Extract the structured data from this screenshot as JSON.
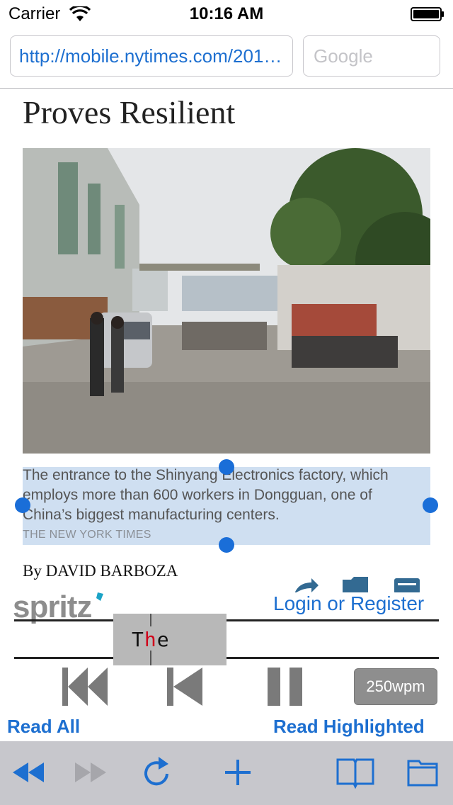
{
  "status_bar": {
    "carrier": "Carrier",
    "time": "10:16 AM"
  },
  "address_bar": {
    "url": "http://mobile.nytimes.com/2014/...",
    "search_placeholder": "Google"
  },
  "article": {
    "headline": "Proves Resilient",
    "photo_icon": "factory-entrance-photo",
    "caption": "The entrance to the Shinyang Electronics factory, which employs more than 600 workers in Dongguan, one of China’s biggest manufacturing centers.",
    "credit": "THE NEW YORK TIMES",
    "byline": "By DAVID BARBOZA"
  },
  "spritz": {
    "logo": "spritz",
    "login_link": "Login or Register",
    "word_prefix": "T",
    "word_pivot": "h",
    "word_suffix": "e",
    "wpm": "250wpm",
    "read_all": "Read All",
    "read_highlighted": "Read Highlighted",
    "controls": [
      "skip-to-start-icon",
      "back-sentence-icon",
      "pause-icon"
    ]
  },
  "toolbar": {
    "icons": [
      "back-icon",
      "forward-icon",
      "reload-icon",
      "add-icon",
      "bookmarks-icon",
      "tabs-icon"
    ]
  },
  "colors": {
    "accent": "#1d6fd0",
    "selection": "#cfdff1",
    "handle": "#1a6ed8",
    "pivot": "#d0021b",
    "toolbar": "#c7c7cc"
  }
}
